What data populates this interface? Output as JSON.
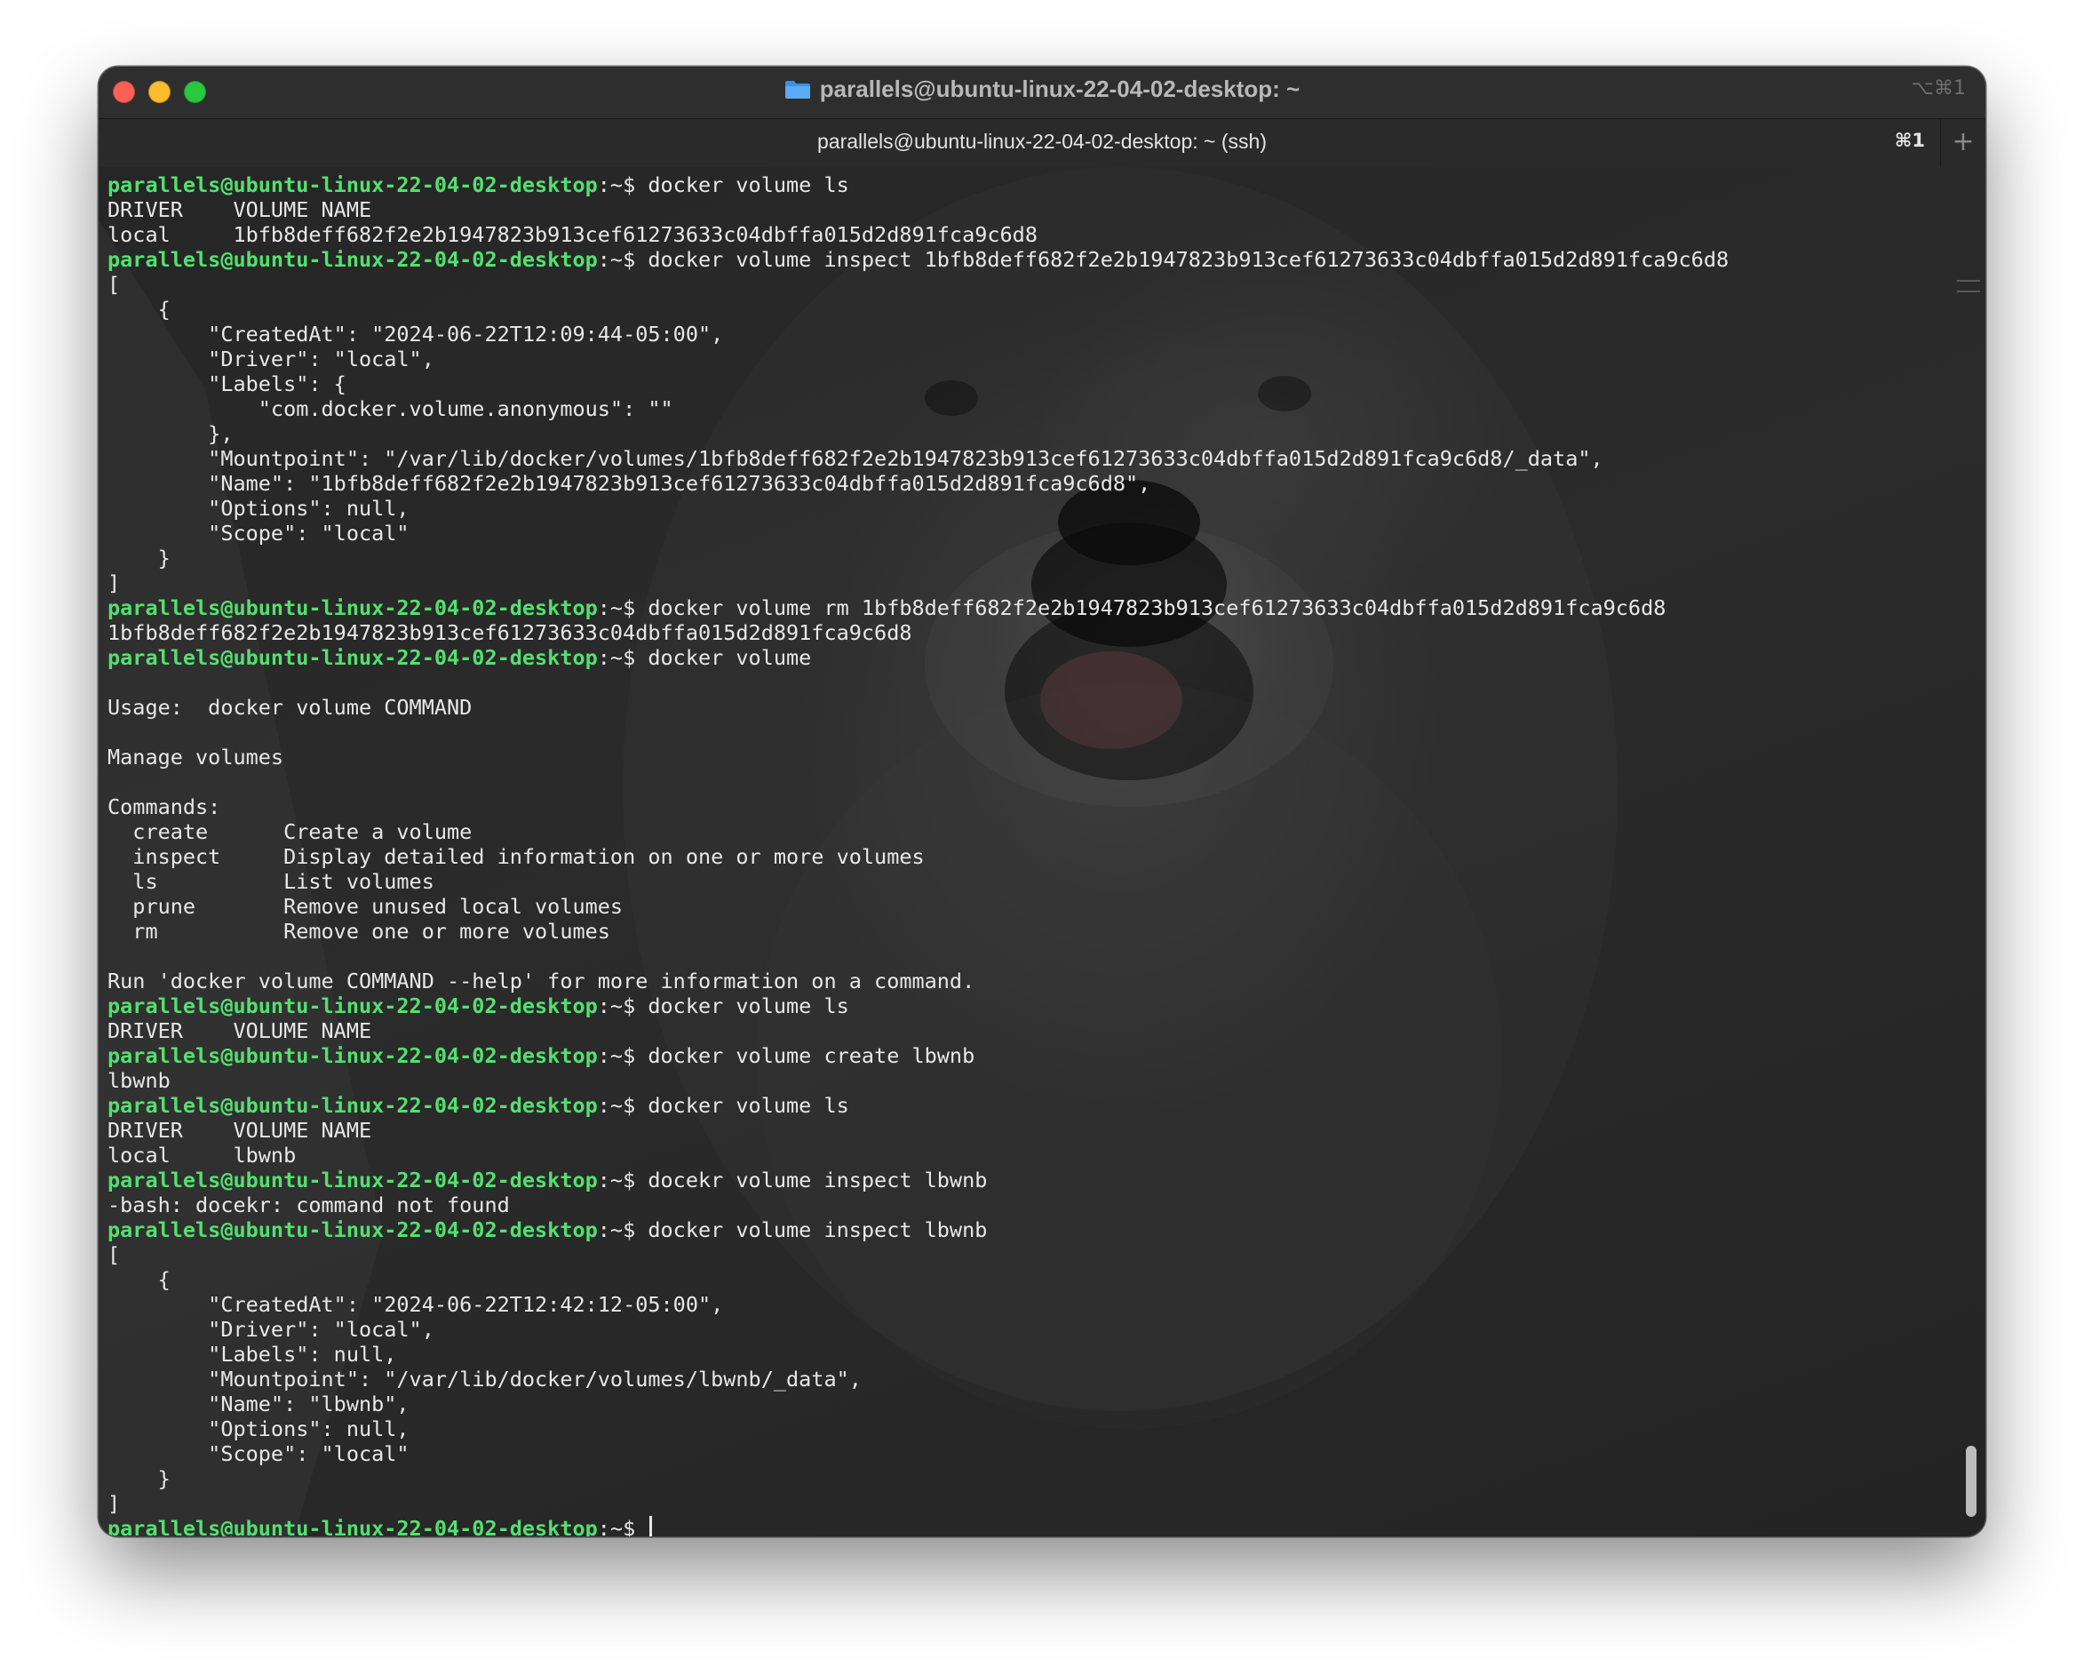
{
  "window": {
    "title": "parallels@ubuntu-linux-22-04-02-desktop: ~",
    "shortcut": "⌥⌘1"
  },
  "tab": {
    "title": "parallels@ubuntu-linux-22-04-02-desktop: ~ (ssh)",
    "shortcut": "⌘1",
    "new_tab": "+"
  },
  "terminal": {
    "prompt_host": "parallels@ubuntu-linux-22-04-02-desktop",
    "prompt_suffix": ":~$ ",
    "lines": [
      {
        "cmd": "docker volume ls"
      },
      {
        "out": "DRIVER    VOLUME NAME"
      },
      {
        "out": "local     1bfb8deff682f2e2b1947823b913cef61273633c04dbffa015d2d891fca9c6d8"
      },
      {
        "cmd": "docker volume inspect 1bfb8deff682f2e2b1947823b913cef61273633c04dbffa015d2d891fca9c6d8"
      },
      {
        "out": "["
      },
      {
        "out": "    {"
      },
      {
        "out": "        \"CreatedAt\": \"2024-06-22T12:09:44-05:00\","
      },
      {
        "out": "        \"Driver\": \"local\","
      },
      {
        "out": "        \"Labels\": {"
      },
      {
        "out": "            \"com.docker.volume.anonymous\": \"\""
      },
      {
        "out": "        },"
      },
      {
        "out": "        \"Mountpoint\": \"/var/lib/docker/volumes/1bfb8deff682f2e2b1947823b913cef61273633c04dbffa015d2d891fca9c6d8/_data\","
      },
      {
        "out": "        \"Name\": \"1bfb8deff682f2e2b1947823b913cef61273633c04dbffa015d2d891fca9c6d8\","
      },
      {
        "out": "        \"Options\": null,"
      },
      {
        "out": "        \"Scope\": \"local\""
      },
      {
        "out": "    }"
      },
      {
        "out": "]"
      },
      {
        "cmd": "docker volume rm 1bfb8deff682f2e2b1947823b913cef61273633c04dbffa015d2d891fca9c6d8"
      },
      {
        "out": "1bfb8deff682f2e2b1947823b913cef61273633c04dbffa015d2d891fca9c6d8"
      },
      {
        "cmd": "docker volume"
      },
      {
        "out": ""
      },
      {
        "out": "Usage:  docker volume COMMAND"
      },
      {
        "out": ""
      },
      {
        "out": "Manage volumes"
      },
      {
        "out": ""
      },
      {
        "out": "Commands:"
      },
      {
        "out": "  create      Create a volume"
      },
      {
        "out": "  inspect     Display detailed information on one or more volumes"
      },
      {
        "out": "  ls          List volumes"
      },
      {
        "out": "  prune       Remove unused local volumes"
      },
      {
        "out": "  rm          Remove one or more volumes"
      },
      {
        "out": ""
      },
      {
        "out": "Run 'docker volume COMMAND --help' for more information on a command."
      },
      {
        "cmd": "docker volume ls"
      },
      {
        "out": "DRIVER    VOLUME NAME"
      },
      {
        "cmd": "docker volume create lbwnb"
      },
      {
        "out": "lbwnb"
      },
      {
        "cmd": "docker volume ls"
      },
      {
        "out": "DRIVER    VOLUME NAME"
      },
      {
        "out": "local     lbwnb"
      },
      {
        "cmd": "docekr volume inspect lbwnb"
      },
      {
        "out": "-bash: docekr: command not found"
      },
      {
        "cmd": "docker volume inspect lbwnb"
      },
      {
        "out": "["
      },
      {
        "out": "    {"
      },
      {
        "out": "        \"CreatedAt\": \"2024-06-22T12:42:12-05:00\","
      },
      {
        "out": "        \"Driver\": \"local\","
      },
      {
        "out": "        \"Labels\": null,"
      },
      {
        "out": "        \"Mountpoint\": \"/var/lib/docker/volumes/lbwnb/_data\","
      },
      {
        "out": "        \"Name\": \"lbwnb\","
      },
      {
        "out": "        \"Options\": null,"
      },
      {
        "out": "        \"Scope\": \"local\""
      },
      {
        "out": "    }"
      },
      {
        "out": "]"
      },
      {
        "cmd": "",
        "cursor": true
      }
    ]
  },
  "colors": {
    "prompt": "#53e06f",
    "text": "#e8e8e8",
    "background": "#262626"
  }
}
